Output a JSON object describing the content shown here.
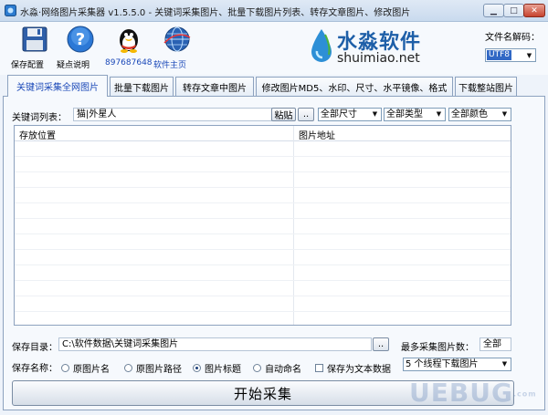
{
  "window": {
    "title": "水淼·网络图片采集器 v1.5.5.0 - 关键词采集图片、批量下载图片列表、转存文章图片、修改图片",
    "minimize_glyph": "▁",
    "maximize_glyph": "□",
    "close_glyph": "✕"
  },
  "toolbar": {
    "items": [
      {
        "label": "保存配置",
        "icon": "floppy-disk-icon"
      },
      {
        "label": "疑点说明",
        "icon": "help-icon"
      },
      {
        "label": "897687648",
        "icon": "qq-penguin-icon"
      },
      {
        "label": "软件主页",
        "icon": "globe-icon"
      }
    ],
    "brand_cn": "水淼软件",
    "brand_en": "shuimiao.net",
    "encoding_label": "文件名解码：",
    "encoding_value": "UTF8"
  },
  "tabs": [
    {
      "label": "关键词采集全网图片",
      "active": true
    },
    {
      "label": "批量下载图片",
      "active": false
    },
    {
      "label": "转存文章中图片",
      "active": false
    },
    {
      "label": "修改图片MD5、水印、尺寸、水平镜像、格式",
      "active": false
    },
    {
      "label": "下载整站图片",
      "active": false
    }
  ],
  "keyword_panel": {
    "keyword_label": "关键词列表：",
    "keyword_value": "猫|外星人",
    "paste_button": "粘贴",
    "more_button": "..",
    "size_select": "全部尺寸",
    "type_select": "全部类型",
    "color_select": "全部颜色",
    "columns": [
      "存放位置",
      "图片地址"
    ],
    "save_dir_label": "保存目录：",
    "save_dir_value": "C:\\软件数据\\关键词采集图片",
    "browse_button": "..",
    "max_count_label": "最多采集图片数：",
    "max_count_value": "全部",
    "save_name_label": "保存名称：",
    "name_options": [
      {
        "label": "原图片名",
        "selected": false
      },
      {
        "label": "原图片路径",
        "selected": false
      },
      {
        "label": "图片标题",
        "selected": true
      },
      {
        "label": "自动命名",
        "selected": false
      }
    ],
    "save_text_label": "保存为文本数据",
    "threads_select": "5 个线程下载图片",
    "start_button": "开始采集"
  },
  "watermark": {
    "text": "UEBUG",
    "suffix": ".com"
  },
  "colors": {
    "accent": "#1a48b8",
    "background": "#eef3fa",
    "brand_blue": "#1e5fa8"
  }
}
